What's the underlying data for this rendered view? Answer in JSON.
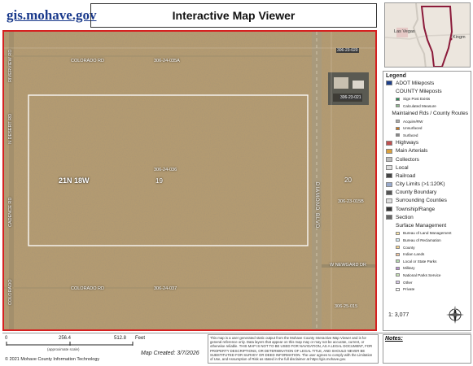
{
  "header": {
    "site_link": "gis.mohave.gov",
    "title": "Interactive Map Viewer"
  },
  "inset_map": {
    "labels": [
      "Las Vegas",
      "Kingm"
    ]
  },
  "map": {
    "road_labels": {
      "colorado_top": "COLORADO RD",
      "colorado_bottom": "COLORADO RD",
      "diamond_blvd": "DIAMOND BLVD",
      "w_newgard": "W NEWGARD DR",
      "left_rd_top": "RIVERVIEW RD",
      "left_rd_mid": "N DESERT RD",
      "left_rd_low": "CADENCE RD",
      "left_rd_bot": "COLORADO"
    },
    "parcel_labels": {
      "p1": "306-24-035A",
      "p2": "306-24-036",
      "p3": "306-24-037",
      "p4": "306-23-020",
      "p5": "306-23-021",
      "p6": "306-23-015B",
      "p7": "306-25-015"
    },
    "township": "21N 18W",
    "section_left": "19",
    "section_right": "20"
  },
  "legend": {
    "title": "Legend",
    "items": [
      {
        "label": "ADOT Mileposts",
        "sub": false,
        "color": "#1d3f8a"
      },
      {
        "label": "COUNTY Mileposts",
        "sub": false,
        "color": ""
      },
      {
        "label": "Sign Post Exists",
        "sub": true,
        "color": "#2e8b57"
      },
      {
        "label": "Calculated Measure",
        "sub": true,
        "color": "#8fbc8f"
      },
      {
        "label": "Maintained Rds / County Routes",
        "sub": false,
        "color": ""
      },
      {
        "label": "Acquire/RW",
        "sub": true,
        "color": "#aaaaaa"
      },
      {
        "label": "Unsurfaced",
        "sub": true,
        "color": "#c8741e"
      },
      {
        "label": "Surfaced",
        "sub": true,
        "color": "#888888"
      },
      {
        "label": "Highways",
        "sub": false,
        "color": "#c05050"
      },
      {
        "label": "Main Arterials",
        "sub": false,
        "color": "#d8a040"
      },
      {
        "label": "Collectors",
        "sub": false,
        "color": "#bbbbbb"
      },
      {
        "label": "Local",
        "sub": false,
        "color": "#dddddd"
      },
      {
        "label": "Railroad",
        "sub": false,
        "color": "#444444"
      },
      {
        "label": "City Limits (>1:120K)",
        "sub": false,
        "color": "#9ac"
      },
      {
        "label": "County Boundary",
        "sub": false,
        "color": "#555555"
      },
      {
        "label": "Surrounding Counties",
        "sub": false,
        "color": "#dddddd"
      },
      {
        "label": "Township/Range",
        "sub": false,
        "color": "#333333"
      },
      {
        "label": "Section",
        "sub": false,
        "color": "#666666"
      },
      {
        "label": "Surface Management",
        "sub": false,
        "color": ""
      },
      {
        "label": "Bureau of Land Management",
        "sub": true,
        "color": "#fde7a7"
      },
      {
        "label": "Bureau of Reclamation",
        "sub": true,
        "color": "#d7edf6"
      },
      {
        "label": "County",
        "sub": true,
        "color": "#f6d38b"
      },
      {
        "label": "Indian Lands",
        "sub": true,
        "color": "#f5c8a0"
      },
      {
        "label": "Local or State Parks",
        "sub": true,
        "color": "#b6d9b0"
      },
      {
        "label": "Military",
        "sub": true,
        "color": "#b98fcf"
      },
      {
        "label": "National Parks Service",
        "sub": true,
        "color": "#c6e0b4"
      },
      {
        "label": "Other",
        "sub": true,
        "color": "#d9c9e9"
      },
      {
        "label": "Private",
        "sub": true,
        "color": "#ffffff"
      }
    ]
  },
  "scale": {
    "ratio": "1: 3,077",
    "ticks": [
      "0",
      "256.4",
      "512.8"
    ],
    "unit": "Feet",
    "note": "(approximate scale)"
  },
  "footer": {
    "copyright": "© 2021 Mohave County Information Technology",
    "map_created": "Map Created: 3/7/2026",
    "disclaimer": "This map is a user generated static output from the Mohave County Interactive Map Viewer and is for general reference only. Data layers that appear on this map may or may not be accurate, current, or otherwise reliable. THIS MAP IS NOT TO BE USED FOR NAVIGATION, AS A LEGAL DOCUMENT, FOR PROPERTY DESCRIPTIONS, OR DETERMINATION OF LEGAL TITLE, AND SHOULD NEVER BE SUBSTITUTED FOR SURVEY OR DEED INFORMATION. The user agrees to comply with the Limitation of Use, and Assumption of Risk as stated in the full disclaimer at https://gis.mohave.gov.",
    "notes_label": "Notes:"
  }
}
